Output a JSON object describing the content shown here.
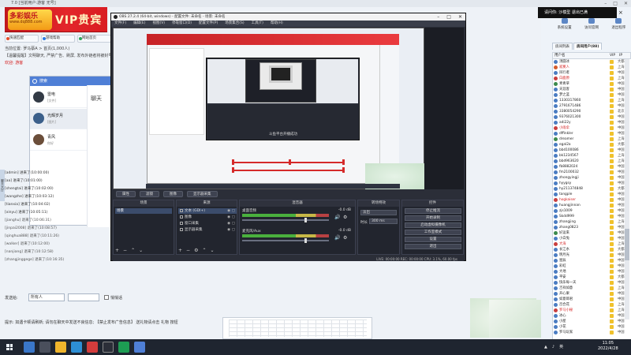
{
  "app": {
    "titlebar": "7.0 [当前用户:游客 无号]",
    "logo_badge_top": "多彩娱乐",
    "logo_badge_sub": "www.dq888.com",
    "logo_vip": "VIP贵宾",
    "toolbar": [
      "快速匹配",
      "游戏帮助",
      "网站首页"
    ],
    "notice": [
      {
        "text": "当前位置: 罗马蔡A > 首页(1,000人)",
        "red": false
      },
      {
        "text": "【温馨提醒】文明聊天, 严禁广告、刷屏, 发布外链者将被封号。",
        "red": false
      },
      {
        "text": "欢迎: 游客",
        "red": true
      }
    ],
    "side_tab": "聊天大厅",
    "log": [
      {
        "text": "[admin] 进来了(10:00:00)",
        "leave": false
      },
      {
        "text": "[aa] 进来了(10:01:00)",
        "leave": false
      },
      {
        "text": "[shengtai] 进来了(10:02:00)",
        "leave": false
      },
      {
        "text": "[wangzhe] 进来了(10:03:12)",
        "leave": false
      },
      {
        "text": "[tianxia] 进来了(10:04:02)",
        "leave": false
      },
      {
        "text": "[xinyu] 进来了(10:05:11)",
        "leave": false
      },
      {
        "text": "[jianghu] 退来了(10:06:31)",
        "leave": true
      },
      {
        "text": "[jinpai2008] 退来了(10:08:57)",
        "leave": true
      },
      {
        "text": "[qinghua888] 退来了(10:11:26)",
        "leave": true
      },
      {
        "text": "[walker] 退来了(10:12:00)",
        "leave": true
      },
      {
        "text": "[nanjiang] 退来了(10:12:58)",
        "leave": true
      },
      {
        "text": "[zhangjinggege] 退来了(10:16:35)",
        "leave": true
      }
    ],
    "input_label": "发送给:",
    "input_target": "所有人",
    "input_check_label": "悄悄话",
    "hint": "提示: 如遇卡顿请刷新;  请勿在聊天中发送不良信息;  【禁止发布广告信息】 送礼物请点击 礼物 按钮"
  },
  "qq": {
    "title": "搜索",
    "chat_title": "聊天",
    "items": [
      {
        "name": "雷电",
        "sub": "[文件]",
        "time": "11:04",
        "active": false,
        "color": "#333a45"
      },
      {
        "name": "光辉岁月",
        "sub": "[图片]",
        "time": "11:02",
        "active": true,
        "color": "#3b5f8a"
      },
      {
        "name": "青风",
        "sub": "你好",
        "time": "11:01",
        "active": false,
        "color": "#6b4e3a"
      }
    ]
  },
  "right_panel": {
    "popup": "请问你: 沙模型 退出已满",
    "icons": [
      "系统设置",
      "访问官网",
      "退出程序"
    ],
    "tabs": [
      "房间列表",
      "房间用户(88)"
    ],
    "headers": [
      "用户名",
      "VIP",
      "IP"
    ],
    "users": [
      {
        "name": "汤圆冰",
        "ip": "大都",
        "red": false,
        "color": "#4a7cc2"
      },
      {
        "name": "寂寞人",
        "ip": "上海",
        "red": true,
        "color": "#d45c2c"
      },
      {
        "name": "风行者",
        "ip": "中国",
        "red": false,
        "color": "#4a7cc2"
      },
      {
        "name": "白鹿原",
        "ip": "上海",
        "red": true,
        "color": "#c93e3e"
      },
      {
        "name": "青青草",
        "ip": "中国",
        "red": false,
        "color": "#3c8a4c"
      },
      {
        "name": "天涯客",
        "ip": "中国",
        "red": false,
        "color": "#4a7cc2"
      },
      {
        "name": "梦之蓝",
        "ip": "中国",
        "red": false,
        "color": "#4a7cc2"
      },
      {
        "name": "1330317860",
        "ip": "上海",
        "red": false,
        "color": "#4a7cc2"
      },
      {
        "name": "2791671486",
        "ip": "中国",
        "red": false,
        "color": "#4a7cc2"
      },
      {
        "name": "3380054290",
        "ip": "北京",
        "red": false,
        "color": "#4a7cc2"
      },
      {
        "name": "9376021300",
        "ip": "中国",
        "red": false,
        "color": "#4a7cc2"
      },
      {
        "name": "adi22y",
        "ip": "中国",
        "red": false,
        "color": "#4a7cc2"
      },
      {
        "name": "小雨伞",
        "ip": "中国",
        "red": true,
        "color": "#c93e3e"
      },
      {
        "name": "dffinkler",
        "ip": "中国",
        "red": false,
        "color": "#4a7cc2"
      },
      {
        "name": "dreamer",
        "ip": "上海",
        "red": false,
        "color": "#3c8a4c"
      },
      {
        "name": "egal2a",
        "ip": "大都",
        "red": false,
        "color": "#4a7cc2"
      },
      {
        "name": "bbd100086",
        "ip": "中国",
        "red": false,
        "color": "#4a7cc2"
      },
      {
        "name": "bk1234567",
        "ip": "上海",
        "red": false,
        "color": "#4a7cc2"
      },
      {
        "name": "bbd963620",
        "ip": "上海",
        "red": false,
        "color": "#4a7cc2"
      },
      {
        "name": "fb8882024",
        "ip": "中国",
        "red": false,
        "color": "#4a7cc2"
      },
      {
        "name": "fm2100032",
        "ip": "中国",
        "red": false,
        "color": "#4a7cc2"
      },
      {
        "name": "zhongyingji",
        "ip": "中国",
        "red": false,
        "color": "#4a7cc2"
      },
      {
        "name": "hyygsy",
        "ip": "中国",
        "red": false,
        "color": "#4a7cc2"
      },
      {
        "name": "hy211374848",
        "ip": "大都",
        "red": false,
        "color": "#4a7cc2"
      },
      {
        "name": "tangple",
        "ip": "中国",
        "red": false,
        "color": "#4a7cc2"
      },
      {
        "name": "hogkaiser",
        "ip": "中国",
        "red": true,
        "color": "#c93e3e"
      },
      {
        "name": "huangjinnan",
        "ip": "中国",
        "red": false,
        "color": "#4a7cc2"
      },
      {
        "name": "zjs1009",
        "ip": "中国",
        "red": false,
        "color": "#4a7cc2"
      },
      {
        "name": "Skdd999",
        "ip": "中国",
        "red": false,
        "color": "#4a7cc2"
      },
      {
        "name": "zhangjing",
        "ip": "上海",
        "red": false,
        "color": "#4a7cc2"
      },
      {
        "name": "zhang0823",
        "ip": "中国",
        "red": false,
        "color": "#4a7cc2"
      },
      {
        "name": "好运来",
        "ip": "中国",
        "red": false,
        "color": "#3c8a4c"
      },
      {
        "name": "小白兔",
        "ip": "中国",
        "red": false,
        "color": "#4a7cc2"
      },
      {
        "name": "大海",
        "ip": "上海",
        "red": true,
        "color": "#c93e3e"
      },
      {
        "name": "长江水",
        "ip": "大都",
        "red": false,
        "color": "#4a7cc2"
      },
      {
        "name": "明月光",
        "ip": "中国",
        "red": false,
        "color": "#4a7cc2"
      },
      {
        "name": "星辰",
        "ip": "中国",
        "red": false,
        "color": "#4a7cc2"
      },
      {
        "name": "彩虹",
        "ip": "中国",
        "red": false,
        "color": "#4a7cc2"
      },
      {
        "name": "大地",
        "ip": "中国",
        "red": false,
        "color": "#4a7cc2"
      },
      {
        "name": "平安",
        "ip": "大都",
        "red": false,
        "color": "#4a7cc2"
      },
      {
        "name": "快乐每一天",
        "ip": "中国",
        "red": false,
        "color": "#4a7cc2"
      },
      {
        "name": "吉祥如意",
        "ip": "上海",
        "red": false,
        "color": "#4a7cc2"
      },
      {
        "name": "开心果",
        "ip": "中国",
        "red": false,
        "color": "#4a7cc2"
      },
      {
        "name": "如意郎君",
        "ip": "中国",
        "red": false,
        "color": "#4a7cc2"
      },
      {
        "name": "百合花",
        "ip": "上海",
        "red": false,
        "color": "#4a7cc2"
      },
      {
        "name": "罗马小秘",
        "ip": "上海",
        "red": true,
        "color": "#c93e3e"
      },
      {
        "name": "冰心",
        "ip": "中国",
        "red": false,
        "color": "#4a7cc2"
      },
      {
        "name": "小屋",
        "ip": "中国",
        "red": false,
        "color": "#4a7cc2"
      },
      {
        "name": "小花",
        "ip": "中国",
        "red": false,
        "color": "#4a7cc2"
      },
      {
        "name": "罗马玩家",
        "ip": "中国",
        "red": false,
        "color": "#4a7cc2"
      }
    ]
  },
  "obs": {
    "title": "OBS 27.2.4 (64-bit, windows) - 配置文件: 未命名 - 场景: 未命名",
    "menu": [
      "文件(F)",
      "编辑(E)",
      "视图(V)",
      "停靠窗口(D)",
      "配置文件(P)",
      "场景集合(S)",
      "工具(T)",
      "帮助(H)"
    ],
    "nested_caption": "斗鱼平台开播成功",
    "status_row": [
      "属性",
      "滤镜",
      "图像",
      "显示器采集"
    ],
    "docks": {
      "scenes": "场景",
      "sources": "来源",
      "mixer": "混音器",
      "transitions": "转场特效",
      "controls": "控件"
    },
    "scene_name": "场景",
    "sources": [
      {
        "name": "文本 (GDI+)",
        "sel": true
      },
      {
        "name": "图像",
        "sel": false
      },
      {
        "name": "窗口采集",
        "sel": false
      },
      {
        "name": "显示器采集",
        "sel": false
      }
    ],
    "mixer": [
      {
        "name": "桌面音频",
        "db": "-0.0 dB",
        "level": 0.72
      },
      {
        "name": "麦克风/Aux",
        "db": "-0.0 dB",
        "level": 0.72
      }
    ],
    "transition_select": "淡出",
    "transition_dur_label": "时长",
    "transition_dur": "300 ms",
    "controls": [
      "停止推流",
      "开始录制",
      "启动虚拟摄像机",
      "工作室模式",
      "设置",
      "退出"
    ],
    "statusbar": "LIVE: 00:00:00   REC: 00:00:00   CPU: 3.1%, 60.00 fps"
  },
  "taskbar": {
    "tray": "英",
    "time": "11:05",
    "date": "2022/4/28"
  }
}
